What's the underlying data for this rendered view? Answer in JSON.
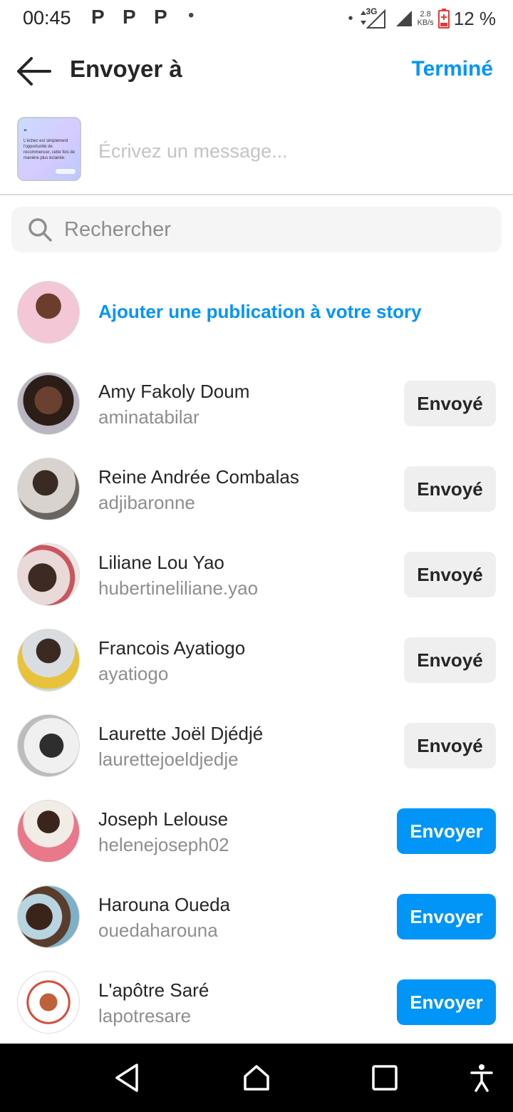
{
  "status_bar": {
    "time": "00:45",
    "app_icons": [
      "P",
      "P",
      "P"
    ],
    "network": "3G",
    "speed_value": "2.8",
    "speed_unit": "KB/s",
    "battery": "12 %"
  },
  "header": {
    "title": "Envoyer à",
    "done_label": "Terminé"
  },
  "message": {
    "placeholder": "Écrivez un message...",
    "preview_quote": "“",
    "preview_text": "L'échec est simplement l'opportunité de recommencer, cette fois de manière plus éclairée."
  },
  "search": {
    "placeholder": "Rechercher"
  },
  "story": {
    "label": "Ajouter une publication à votre story"
  },
  "contacts": [
    {
      "name": "Amy Fakoly Doum",
      "username": "aminatabilar",
      "status": "Envoyé"
    },
    {
      "name": "Reine Andrée Combalas",
      "username": "adjibaronne",
      "status": "Envoyé"
    },
    {
      "name": "Liliane Lou Yao",
      "username": "hubertineliliane.yao",
      "status": "Envoyé"
    },
    {
      "name": "Francois Ayatiogo",
      "username": "ayatiogo",
      "status": "Envoyé"
    },
    {
      "name": "Laurette Joël Djédjé",
      "username": "laurettejoeldjedje",
      "status": "Envoyé"
    },
    {
      "name": "Joseph Lelouse",
      "username": "helenejoseph02",
      "status": "Envoyer"
    },
    {
      "name": "Harouna Oueda",
      "username": "ouedaharouna",
      "status": "Envoyer"
    },
    {
      "name": "L'apôtre Saré",
      "username": "lapotresare",
      "status": "Envoyer"
    }
  ],
  "colors": {
    "accent": "#0095f6",
    "sent_button_bg": "#efefef",
    "nav_bar_bg": "#000000"
  },
  "nav_bar": {
    "icons": [
      "back-triangle-icon",
      "home-icon",
      "recents-square-icon",
      "accessibility-icon"
    ]
  }
}
